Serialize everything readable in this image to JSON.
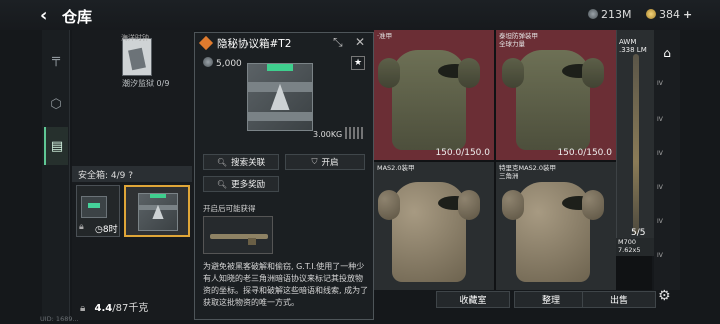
{
  "header": {
    "back_icon": "chevron-left-icon",
    "title": "仓库",
    "silver_amount": "213M",
    "gold_amount": "384"
  },
  "left_nav": {
    "items": [
      {
        "icon": "pistol-icon"
      },
      {
        "icon": "badge-icon"
      },
      {
        "icon": "clipboard-icon",
        "active": true
      }
    ]
  },
  "left_panel": {
    "card_caption": "海洋时钟",
    "card_label": "潮汐监狱 0/9"
  },
  "safe_box": {
    "label": "安全箱: 4/9 ?",
    "timer": "8时"
  },
  "weight": {
    "current": "4.4",
    "max": "/87千克"
  },
  "popup": {
    "title": "隐秘协议箱#T2",
    "price": "5,000",
    "weight": "3.00KG",
    "btn_search": "搜索关联",
    "btn_open": "开启",
    "btn_more": "更多奖励",
    "subheading": "开启后可能获得",
    "description": "为避免被黑客破解和偷窃, G.T.I.使用了一种少有人知晓的老三角洲暗语协议来标记其投放物资的坐标。探寻和破解这些暗语和线索, 成为了获取这批物资的唯一方式。"
  },
  "grid": {
    "cells": [
      {
        "name": "‧准甲",
        "durability": ""
      },
      {
        "name": "泰坦防弹装甲\n全球力量",
        "durability": ""
      },
      {
        "name": "",
        "durability": "150.0/150.0"
      },
      {
        "name": "",
        "durability": "150.0/150.0"
      },
      {
        "name": "MAS2.0装甲",
        "durability": ""
      },
      {
        "name": "特里克MAS2.0装甲\n三角洲",
        "durability": ""
      }
    ]
  },
  "rifle_col": {
    "name": "AWM\n.338 LM",
    "count": "5/5",
    "m700": "M700\n7.62x5"
  },
  "tiers": [
    "IV",
    "IV",
    "IV",
    "IV",
    "IV",
    "IV"
  ],
  "bottom": {
    "collect": "收藏室",
    "sort": "整理",
    "sell": "出售",
    "uid": "UID: 1689..."
  }
}
